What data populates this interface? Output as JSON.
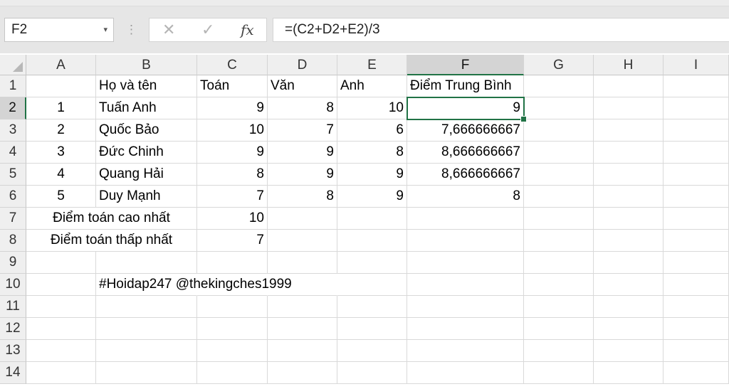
{
  "formula_bar": {
    "name_box": "F2",
    "name_box_arrow": "▾",
    "cancel_icon": "✕",
    "enter_icon": "✓",
    "fx_icon": "fx",
    "formula": "=(C2+D2+E2)/3"
  },
  "columns": [
    "A",
    "B",
    "C",
    "D",
    "E",
    "F",
    "G",
    "H",
    "I"
  ],
  "rows": [
    "1",
    "2",
    "3",
    "4",
    "5",
    "6",
    "7",
    "8",
    "9",
    "10",
    "11",
    "12",
    "13",
    "14"
  ],
  "active_cell": "F2",
  "sheet": {
    "header": {
      "B": "Họ và tên",
      "C": "Toán",
      "D": "Văn",
      "E": "Anh",
      "F": "Điểm Trung Bình"
    },
    "students": [
      {
        "A": "1",
        "B": "Tuấn Anh",
        "C": "9",
        "D": "8",
        "E": "10",
        "F": "9"
      },
      {
        "A": "2",
        "B": "Quốc Bảo",
        "C": "10",
        "D": "7",
        "E": "6",
        "F": "7,666666667"
      },
      {
        "A": "3",
        "B": "Đức Chinh",
        "C": "9",
        "D": "9",
        "E": "8",
        "F": "8,666666667"
      },
      {
        "A": "4",
        "B": "Quang Hải",
        "C": "8",
        "D": "9",
        "E": "9",
        "F": "8,666666667"
      },
      {
        "A": "5",
        "B": "Duy Mạnh",
        "C": "7",
        "D": "8",
        "E": "9",
        "F": "8"
      }
    ],
    "max_label": "Điểm toán cao nhất",
    "max_value": "10",
    "min_label": "Điểm toán thấp nhất",
    "min_value": "7",
    "watermark": "#Hoidap247 @thekingches1999"
  }
}
